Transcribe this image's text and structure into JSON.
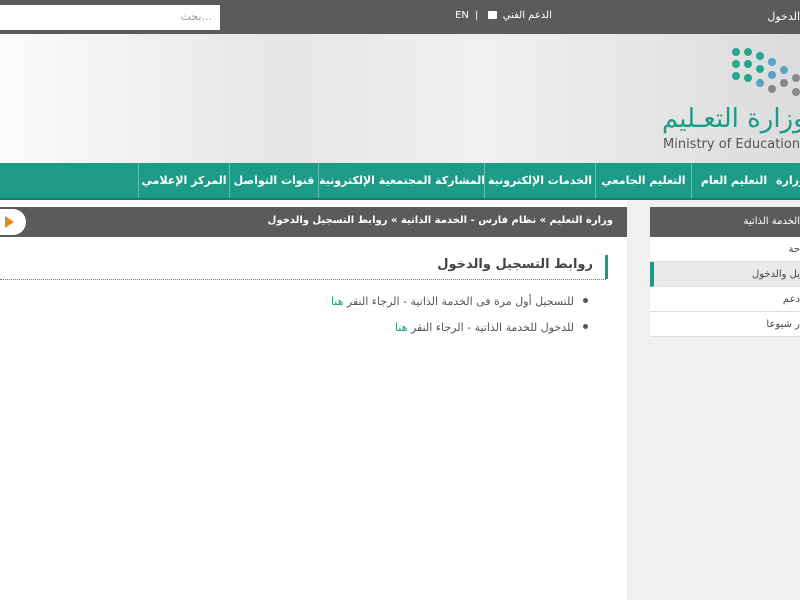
{
  "topbar": {
    "search_placeholder": "بحث...",
    "lang": "EN",
    "separator": "|",
    "support": "الدعم الفني",
    "login": "الدخول"
  },
  "header": {
    "logo_ar": "وزارة التعـليم",
    "logo_en": "Ministry of Education"
  },
  "nav": {
    "items": [
      "وزارة",
      "التعليم العام",
      "التعليم الجامعي",
      "الخدمات الإلكترونية",
      "المشاركة المجتمعية الإلكترونية",
      "قنوات التواصل",
      "المركز الإعلامي"
    ]
  },
  "breadcrumb": "وزارة التعليم » نظام فارس - الخدمة الذاتية » روابط التسجيل والدخول",
  "content": {
    "title": "روابط التسجيل والدخول",
    "items": [
      {
        "text": "للتسجيل أول مرة فى الخدمة الذاتية - الرجاء النقر ",
        "link": "هنا"
      },
      {
        "text": "للدخول للخدمة الذاتية - الرجاء النقر ",
        "link": "هنا"
      }
    ]
  },
  "sidebar": {
    "title": "الخدمة الذاتية",
    "items": [
      "حة",
      "يل والدخول",
      "دعم",
      "ر شيوعا"
    ]
  },
  "colors": {
    "accent": "#1e9b86",
    "topbar": "#5b5b5d",
    "arrow": "#e58a1f"
  }
}
